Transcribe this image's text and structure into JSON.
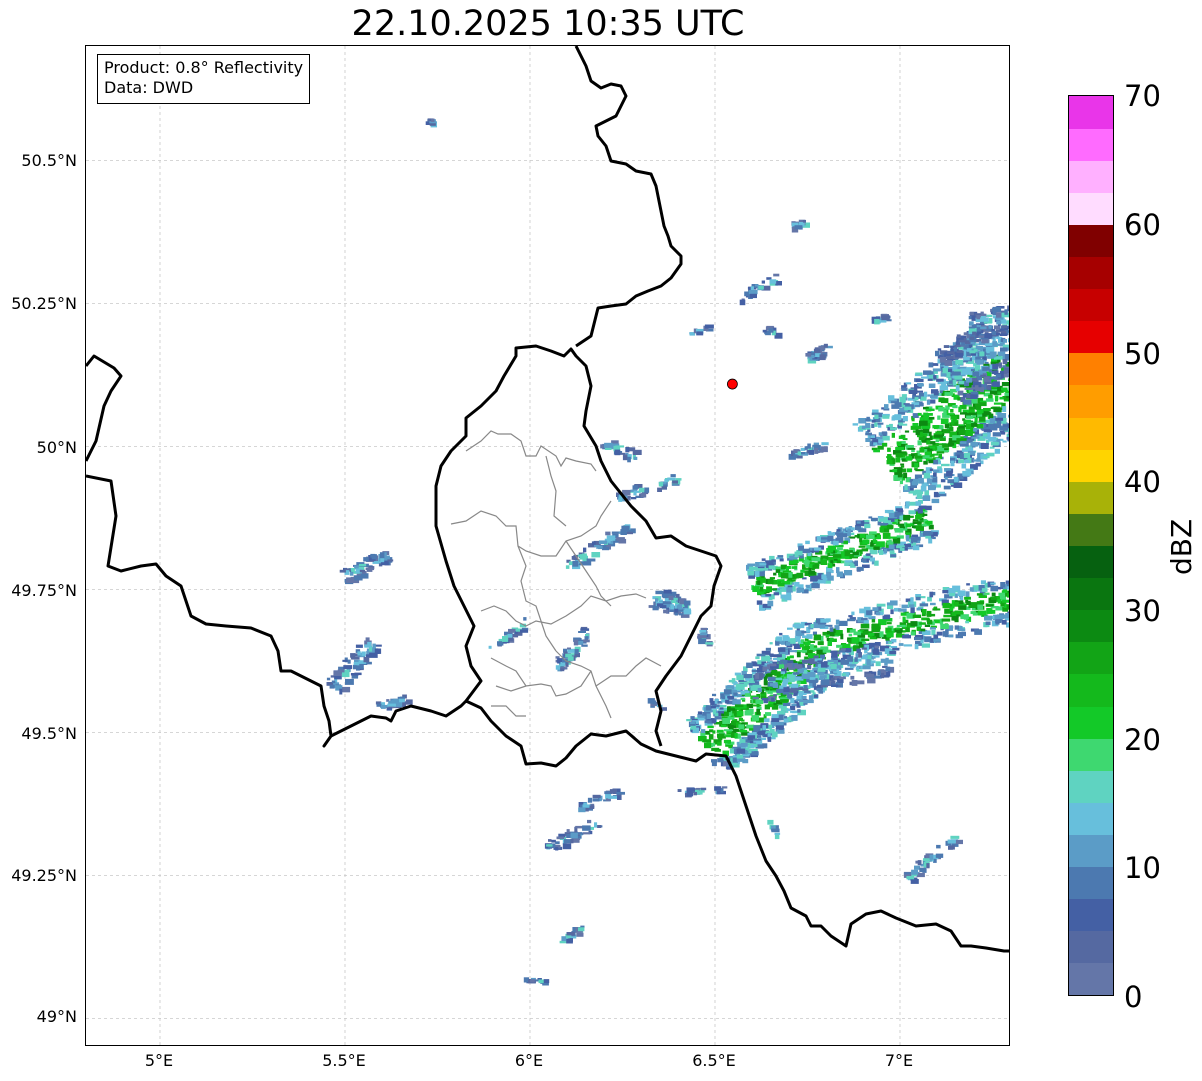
{
  "title": "22.10.2025 10:35 UTC",
  "info_box": {
    "product": "Product: 0.8° Reflectivity",
    "data": "Data: DWD"
  },
  "axes": {
    "lon_ticks": [
      "5°E",
      "5.5°E",
      "6°E",
      "6.5°E",
      "7°E"
    ],
    "lat_ticks": [
      "50.5°N",
      "50.25°N",
      "50°N",
      "49.75°N",
      "49.5°N",
      "49.25°N",
      "49°N"
    ],
    "lon_range": [
      4.8,
      7.3
    ],
    "lat_range": [
      48.95,
      50.7
    ],
    "grid": "dashed gray"
  },
  "colorbar": {
    "label": "dBZ",
    "ticks": [
      "0",
      "10",
      "20",
      "30",
      "40",
      "50",
      "60",
      "70"
    ],
    "range": [
      0,
      70
    ],
    "step": 2.5,
    "colors": [
      "#6476a8",
      "#5569a1",
      "#4460a4",
      "#4c79b0",
      "#5b9cc7",
      "#67bfdc",
      "#5fd3c1",
      "#3ed870",
      "#13c928",
      "#14b91c",
      "#12a416",
      "#0c8a12",
      "#0a7610",
      "#066110",
      "#447915",
      "#a8b208",
      "#ffd400",
      "#ffba00",
      "#ff9d00",
      "#ff8000",
      "#e60000",
      "#c70000",
      "#a60000",
      "#800000",
      "#ffdcff",
      "#ffb0ff",
      "#ff6bff",
      "#e935e9"
    ]
  },
  "radar_site": {
    "lon": 6.547,
    "lat": 50.109,
    "color": "#ff0000"
  }
}
